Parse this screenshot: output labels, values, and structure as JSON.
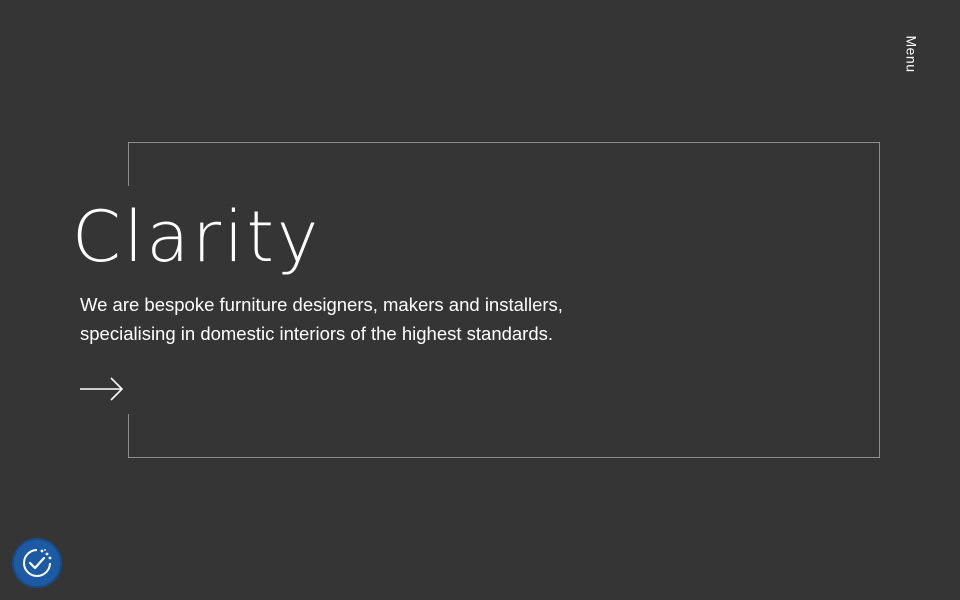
{
  "header": {
    "menu_label": "Menu"
  },
  "hero": {
    "title": "Clarity",
    "description": "We are bespoke furniture designers, makers and installers, specialising in domestic interiors of the highest standards."
  },
  "icons": {
    "arrow": "arrow-right-icon",
    "cookie": "cookie-consent-icon"
  },
  "colors": {
    "background": "#353535",
    "frame": "#8a8a8a",
    "text": "#ffffff",
    "cookie_button": "#1c5aa3"
  }
}
